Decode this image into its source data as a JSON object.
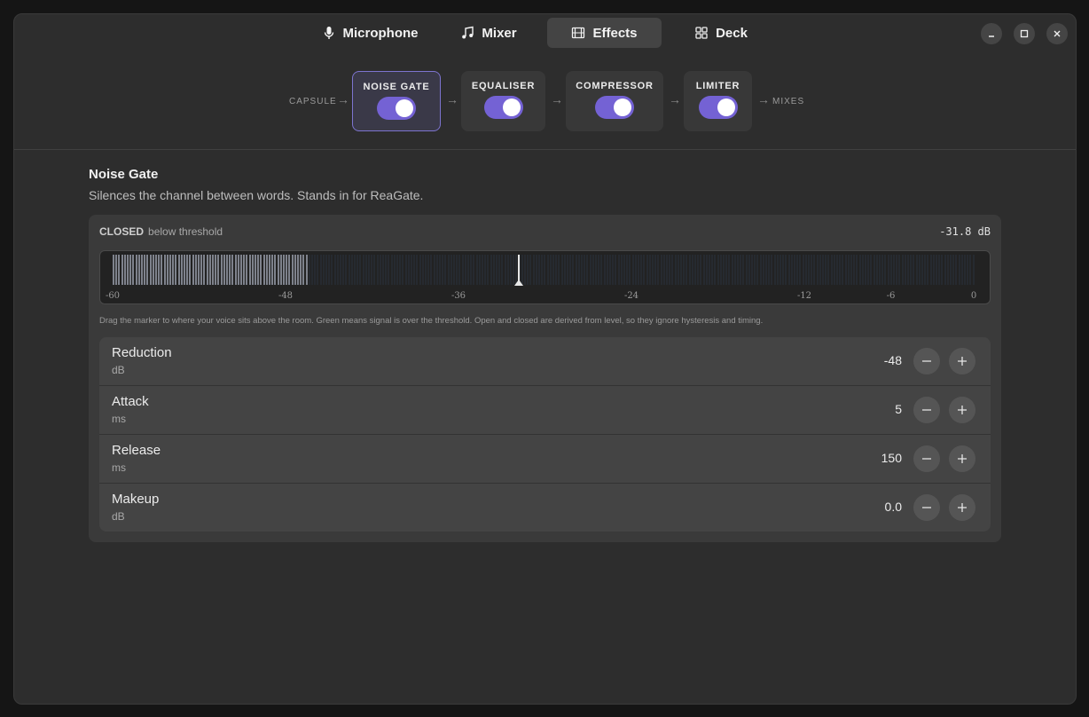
{
  "tabs": [
    {
      "label": "Microphone",
      "icon": "microphone-icon"
    },
    {
      "label": "Mixer",
      "icon": "music-note-icon"
    },
    {
      "label": "Effects",
      "icon": "film-icon",
      "active": true
    },
    {
      "label": "Deck",
      "icon": "grid-icon"
    }
  ],
  "chain": {
    "start_label": "CAPSULE",
    "end_label": "MIXES",
    "effects": [
      {
        "name": "NOISE GATE",
        "enabled": true,
        "selected": true
      },
      {
        "name": "EQUALISER",
        "enabled": true
      },
      {
        "name": "COMPRESSOR",
        "enabled": true
      },
      {
        "name": "LIMITER",
        "enabled": true
      }
    ]
  },
  "section": {
    "title": "Noise Gate",
    "description": "Silences the channel between words. Stands in for ReaGate."
  },
  "meter": {
    "state": "CLOSED",
    "state_detail": "below threshold",
    "level_text": "-31.8 dB",
    "scale_min_db": -60,
    "scale_max_db": 0,
    "signal_db": -46.5,
    "threshold_db": -31.8,
    "ticks": [
      "-60",
      "-48",
      "-36",
      "-24",
      "-12",
      "-6",
      "0"
    ],
    "hint": "Drag the marker to where your voice sits above the room. Green means signal is over the threshold. Open and closed are derived from level, so they ignore hysteresis and timing."
  },
  "params": [
    {
      "name": "Reduction",
      "unit": "dB",
      "value": "-48"
    },
    {
      "name": "Attack",
      "unit": "ms",
      "value": "5"
    },
    {
      "name": "Release",
      "unit": "ms",
      "value": "150"
    },
    {
      "name": "Makeup",
      "unit": "dB",
      "value": "0.0"
    }
  ],
  "colors": {
    "accent": "#7462d4",
    "selected_border": "#7d74cf"
  }
}
